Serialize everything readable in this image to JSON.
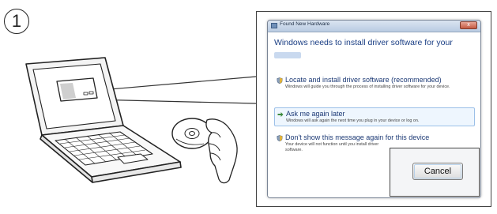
{
  "step": {
    "number": "1"
  },
  "dialog": {
    "title": "Found New Hardware",
    "close_label": "x",
    "heading": "Windows needs to install driver software for your",
    "options": [
      {
        "title": "Locate and install driver software (recommended)",
        "desc": "Windows will guide you through the process of installing driver software for your device.",
        "icon": "shield-icon"
      },
      {
        "title": "Ask me again later",
        "desc": "Windows will ask again the next time you plug in your device or log on.",
        "icon": "arrow-right-icon"
      },
      {
        "title": "Don't show this message again for this device",
        "desc": "Your device will not function until you install driver software.",
        "icon": "shield-icon"
      }
    ],
    "cancel_label": "Cancel"
  },
  "colors": {
    "heading": "#1a3e84",
    "option_title": "#1d3a75",
    "selected_bg": "#eef6fe"
  }
}
